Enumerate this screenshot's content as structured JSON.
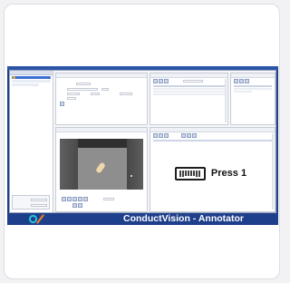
{
  "app": {
    "window_title": "",
    "brand_text": "ConductVision - Annotator"
  },
  "overlay": {
    "key_icon": "keyboard-icon",
    "press_label": "Press 1"
  },
  "colors": {
    "brand_blue": "#1e3f8c",
    "logo_cyan": "#27c3d8",
    "logo_orange": "#f07c2c"
  }
}
